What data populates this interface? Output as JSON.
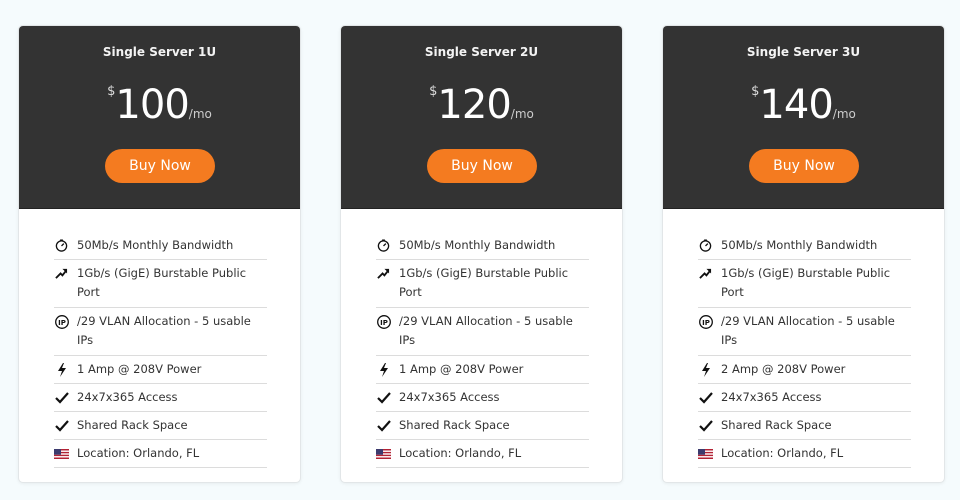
{
  "plans": [
    {
      "name": "Single Server 1U",
      "currency": "$",
      "amount": "100",
      "period": "/mo",
      "button_label": "Buy Now",
      "features": [
        {
          "icon": "gauge-icon",
          "text": "50Mb/s Monthly Bandwidth"
        },
        {
          "icon": "trend-up-arrow-icon",
          "text": "1Gb/s (GigE) Burstable Public Port"
        },
        {
          "icon": "ip-icon",
          "text": "/29 VLAN Allocation - 5 usable IPs"
        },
        {
          "icon": "lightning-bolt-icon",
          "text": "1 Amp @ 208V Power"
        },
        {
          "icon": "checkmark-icon",
          "text": "24x7x365 Access"
        },
        {
          "icon": "checkmark-icon",
          "text": "Shared Rack Space"
        },
        {
          "icon": "us-flag-icon",
          "text": "Location: Orlando, FL"
        }
      ]
    },
    {
      "name": "Single Server 2U",
      "currency": "$",
      "amount": "120",
      "period": "/mo",
      "button_label": "Buy Now",
      "features": [
        {
          "icon": "gauge-icon",
          "text": "50Mb/s Monthly Bandwidth"
        },
        {
          "icon": "trend-up-arrow-icon",
          "text": "1Gb/s (GigE) Burstable Public Port"
        },
        {
          "icon": "ip-icon",
          "text": "/29 VLAN Allocation - 5 usable IPs"
        },
        {
          "icon": "lightning-bolt-icon",
          "text": "1 Amp @ 208V Power"
        },
        {
          "icon": "checkmark-icon",
          "text": "24x7x365 Access"
        },
        {
          "icon": "checkmark-icon",
          "text": "Shared Rack Space"
        },
        {
          "icon": "us-flag-icon",
          "text": "Location: Orlando, FL"
        }
      ]
    },
    {
      "name": "Single Server 3U",
      "currency": "$",
      "amount": "140",
      "period": "/mo",
      "button_label": "Buy Now",
      "features": [
        {
          "icon": "gauge-icon",
          "text": "50Mb/s Monthly Bandwidth"
        },
        {
          "icon": "trend-up-arrow-icon",
          "text": "1Gb/s (GigE) Burstable Public Port"
        },
        {
          "icon": "ip-icon",
          "text": "/29 VLAN Allocation - 5 usable IPs"
        },
        {
          "icon": "lightning-bolt-icon",
          "text": "2 Amp @ 208V Power"
        },
        {
          "icon": "checkmark-icon",
          "text": "24x7x365 Access"
        },
        {
          "icon": "checkmark-icon",
          "text": "Shared Rack Space"
        },
        {
          "icon": "us-flag-icon",
          "text": "Location: Orlando, FL"
        }
      ]
    }
  ],
  "colors": {
    "header_bg": "#333333",
    "accent": "#f47b20",
    "page_bg": "#f5fbfd"
  }
}
